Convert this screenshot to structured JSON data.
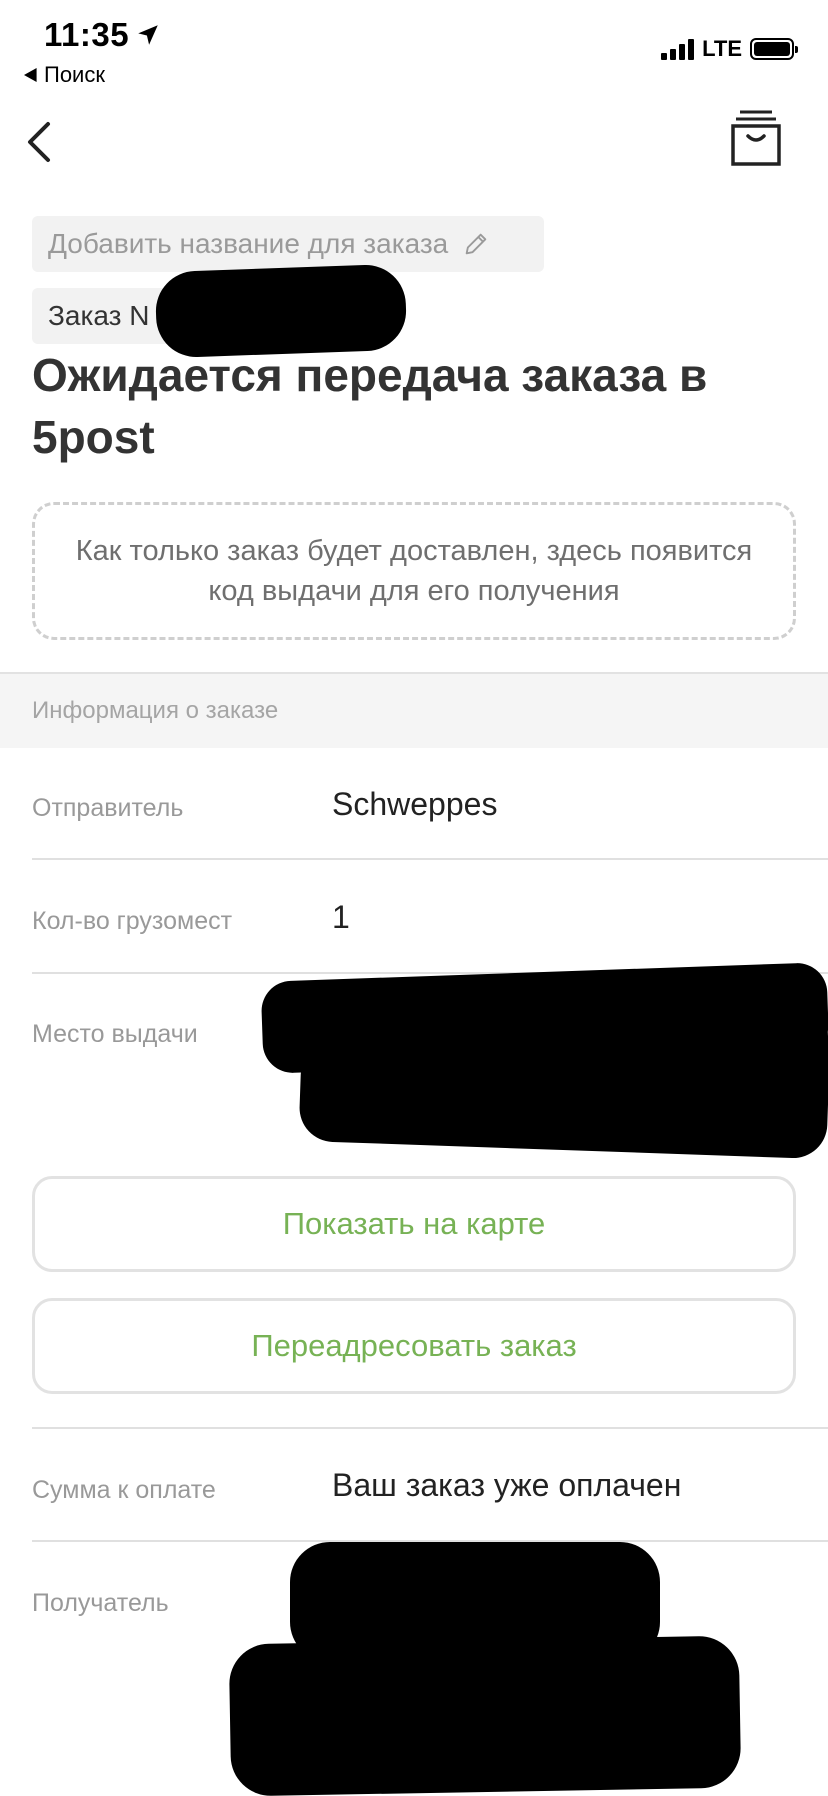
{
  "status_bar": {
    "time": "11:35",
    "back_app": "Поиск",
    "network": "LTE"
  },
  "nav": {
    "back_icon": "chevron-left-icon",
    "archive_icon": "archive-box-icon"
  },
  "order": {
    "add_name_placeholder": "Добавить название для заказа",
    "number_label": "Заказ N",
    "status_title": "Ожидается передача заказа в 5post",
    "pickup_code_note": "Как только заказ будет доставлен, здесь появится код выдачи для его получения"
  },
  "info": {
    "section_title": "Информация о заказе",
    "rows": [
      {
        "label": "Отправитель",
        "value": "Schweppes"
      },
      {
        "label": "Кол-во грузомест",
        "value": "1"
      },
      {
        "label": "Место выдачи",
        "value": ""
      },
      {
        "label": "Сумма к оплате",
        "value": "Ваш заказ уже оплачен"
      },
      {
        "label": "Получатель",
        "value": ""
      }
    ],
    "show_on_map_button": "Показать на карте",
    "redirect_button": "Переадресовать заказ"
  },
  "colors": {
    "accent_green": "#77b255",
    "label_gray": "#999999",
    "band_gray": "#f5f5f5"
  }
}
